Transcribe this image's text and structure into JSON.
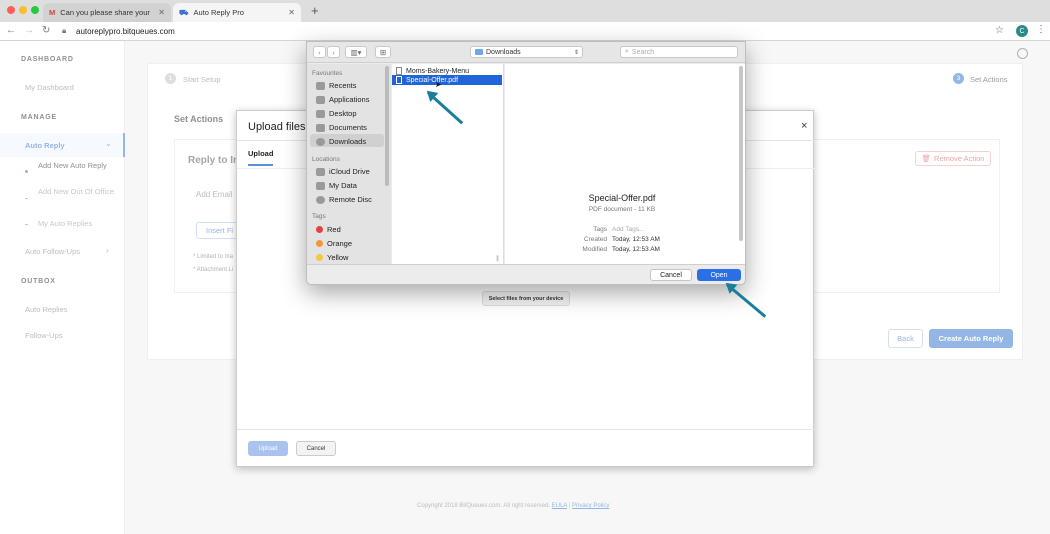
{
  "browser": {
    "tabs": [
      {
        "label": "Can you please share your ma"
      },
      {
        "label": "Auto Reply Pro"
      }
    ],
    "url": "autoreplypro.bitqueues.com",
    "profile_initial": "C"
  },
  "sidebar": {
    "dashboard_header": "DASHBOARD",
    "my_dashboard": "My Dashboard",
    "manage_header": "MANAGE",
    "auto_reply": "Auto Reply",
    "add_new_auto_reply": "Add New Auto Reply",
    "add_new_out_of_office": "Add New Out Of Office",
    "my_auto_replies": "My Auto Replies",
    "auto_follow_ups": "Auto Follow-Ups",
    "outbox_header": "OUTBOX",
    "auto_replies": "Auto Replies",
    "follow_ups": "Follow-Ups"
  },
  "main": {
    "step1": "1",
    "step1_label": "Start Setup",
    "step3": "3",
    "step3_label": "Set Actions",
    "set_actions": "Set Actions",
    "reply_to": "Reply to In",
    "remove_action": "Remove Action",
    "add_email": "Add Email",
    "insert_btn": "Insert Fi",
    "note1": "* Limited to ma",
    "note2": "* Attachment Li",
    "back": "Back",
    "create": "Create Auto Reply",
    "copyright": "Copyright 2018 BitQueues.com. All right reserved.",
    "eula": "EULA",
    "privacy": "Privacy Policy"
  },
  "upload_modal": {
    "title": "Upload files",
    "tab_upload": "Upload",
    "close": "×",
    "select_files": "Select files from your device",
    "upload_btn": "Upload",
    "cancel_btn": "Cancel"
  },
  "finder": {
    "location": "Downloads",
    "search_placeholder": "Search",
    "favourites_header": "Favourites",
    "favourites": [
      "Recents",
      "Applications",
      "Desktop",
      "Documents",
      "Downloads"
    ],
    "locations_header": "Locations",
    "locations": [
      "iCloud Drive",
      "My Data",
      "Remote Disc"
    ],
    "tags_header": "Tags",
    "tags": [
      {
        "name": "Red",
        "color": "#e0443a"
      },
      {
        "name": "Orange",
        "color": "#f19a35"
      },
      {
        "name": "Yellow",
        "color": "#f4c842"
      }
    ],
    "files": [
      "Moms-Bakery-Menu",
      "Special-Offer.pdf"
    ],
    "preview": {
      "name": "Special-Offer.pdf",
      "kind": "PDF document - 11 KB",
      "tags_label": "Tags",
      "tags_value": "Add Tags...",
      "created_label": "Created",
      "created_value": "Today, 12:53 AM",
      "modified_label": "Modified",
      "modified_value": "Today, 12:53 AM"
    },
    "cancel": "Cancel",
    "open": "Open"
  },
  "colors": {
    "accent": "#5b8fd9",
    "finder_select": "#1f64d8",
    "arrow": "#1a7d9a",
    "danger": "#e57373"
  }
}
